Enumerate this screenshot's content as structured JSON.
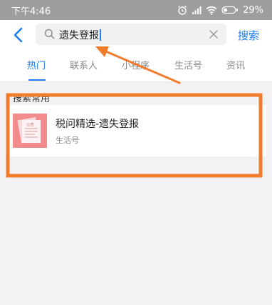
{
  "status_bar": {
    "time": "下午4:46",
    "battery": "29%",
    "icons": [
      "alarm-icon",
      "signal-icon",
      "wifi-icon",
      "battery-icon"
    ]
  },
  "header": {
    "back_icon": "back-chevron-icon",
    "search": {
      "value": "遗失登报",
      "icon": "search-icon",
      "clear_icon": "clear-icon"
    },
    "search_button": "搜索"
  },
  "tabs": [
    {
      "label": "热门",
      "active": true
    },
    {
      "label": "联系人",
      "active": false
    },
    {
      "label": "小程序",
      "active": false
    },
    {
      "label": "生活号",
      "active": false
    },
    {
      "label": "资讯",
      "active": false
    }
  ],
  "section": {
    "title": "搜索常用",
    "items": [
      {
        "title": "税问精选-遗失登报",
        "type": "生活号",
        "thumb_text": "公告"
      }
    ]
  },
  "annotations": {
    "color": "#f07c2c"
  }
}
